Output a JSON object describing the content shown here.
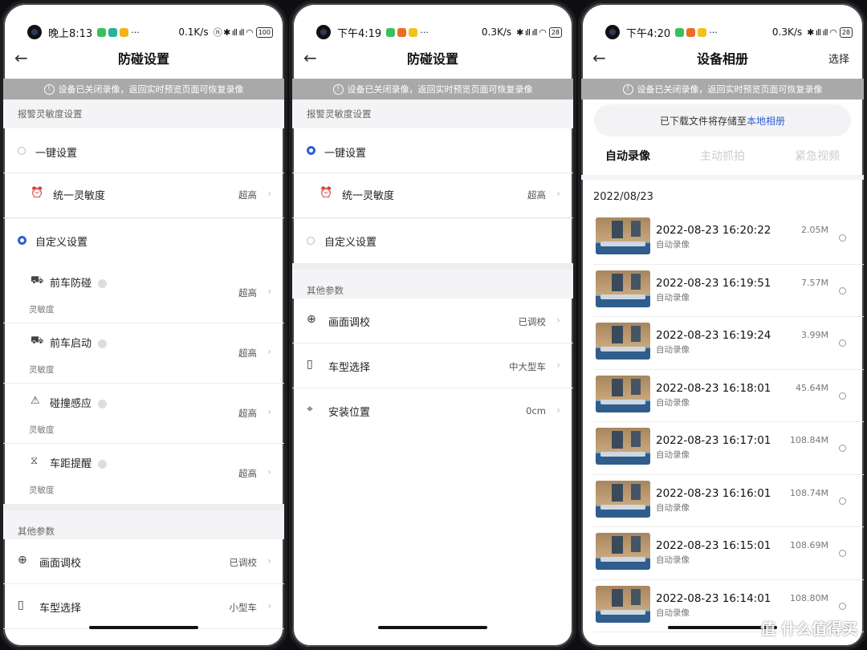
{
  "phone1": {
    "status": {
      "time": "晚上8:13",
      "net": "0.1K/s",
      "battery": "100"
    },
    "title": "防碰设置",
    "warning": "设备已关闭录像，返回实时预览页面可恢复录像",
    "section_alert": "报警灵敏度设置",
    "one_key": "一键设置",
    "unified": "统一灵敏度",
    "unified_value": "超高",
    "custom": "自定义设置",
    "items": [
      {
        "label": "前车防碰",
        "value": "超高",
        "sub": "灵敏度"
      },
      {
        "label": "前车启动",
        "value": "超高",
        "sub": "灵敏度"
      },
      {
        "label": "碰撞感应",
        "value": "超高",
        "sub": "灵敏度"
      },
      {
        "label": "车距提醒",
        "value": "超高",
        "sub": "灵敏度"
      }
    ],
    "section_other": "其他参数",
    "calib": "画面调校",
    "calib_value": "已调校",
    "car": "车型选择",
    "car_value": "小型车"
  },
  "phone2": {
    "status": {
      "time": "下午4:19",
      "net": "0.3K/s",
      "battery": "28"
    },
    "title": "防碰设置",
    "warning": "设备已关闭录像，返回实时预览页面可恢复录像",
    "section_alert": "报警灵敏度设置",
    "one_key": "一键设置",
    "unified": "统一灵敏度",
    "unified_value": "超高",
    "custom": "自定义设置",
    "section_other": "其他参数",
    "calib": "画面调校",
    "calib_value": "已调校",
    "car": "车型选择",
    "car_value": "中大型车",
    "install": "安装位置",
    "install_value": "0cm"
  },
  "phone3": {
    "status": {
      "time": "下午4:20",
      "net": "0.3K/s",
      "battery": "28"
    },
    "title": "设备相册",
    "select": "选择",
    "warning": "设备已关闭录像，返回实时预览页面可恢复录像",
    "note": "已下载文件将存储至",
    "note_link": "本地相册",
    "tabs": [
      "自动录像",
      "主动抓拍",
      "紧急视频"
    ],
    "date": "2022/08/23",
    "videos": [
      {
        "time": "2022-08-23 16:20:22",
        "type": "自动录像",
        "size": "2.05M"
      },
      {
        "time": "2022-08-23 16:19:51",
        "type": "自动录像",
        "size": "7.57M"
      },
      {
        "time": "2022-08-23 16:19:24",
        "type": "自动录像",
        "size": "3.99M"
      },
      {
        "time": "2022-08-23 16:18:01",
        "type": "自动录像",
        "size": "45.64M"
      },
      {
        "time": "2022-08-23 16:17:01",
        "type": "自动录像",
        "size": "108.84M"
      },
      {
        "time": "2022-08-23 16:16:01",
        "type": "自动录像",
        "size": "108.74M"
      },
      {
        "time": "2022-08-23 16:15:01",
        "type": "自动录像",
        "size": "108.69M"
      },
      {
        "time": "2022-08-23 16:14:01",
        "type": "自动录像",
        "size": "108.80M"
      }
    ],
    "watermark": "值 什么值得买"
  }
}
